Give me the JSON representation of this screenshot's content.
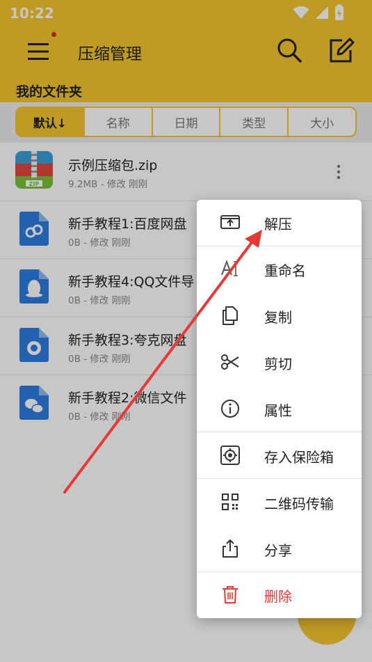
{
  "status": {
    "time": "10:22"
  },
  "appbar": {
    "title": "压缩管理"
  },
  "section": {
    "title": "我的文件夹"
  },
  "sort_tabs": [
    {
      "label": "默认↓",
      "active": true
    },
    {
      "label": "名称"
    },
    {
      "label": "日期"
    },
    {
      "label": "类型"
    },
    {
      "label": "大小"
    }
  ],
  "files": [
    {
      "name": "示例压缩包.zip",
      "meta": "9.2MB - 修改 刚刚",
      "icon": "zip-archive-icon"
    },
    {
      "name": "新手教程1:百度网盘",
      "meta": "0B - 修改 刚刚",
      "icon": "baidu-netdisk-doc-icon"
    },
    {
      "name": "新手教程4:QQ文件导",
      "meta": "0B - 修改 刚刚",
      "icon": "qq-doc-icon"
    },
    {
      "name": "新手教程3:夸克网盘",
      "meta": "0B - 修改 刚刚",
      "icon": "quark-doc-icon"
    },
    {
      "name": "新手教程2:微信文件",
      "meta": "0B - 修改 刚刚",
      "icon": "wechat-doc-icon"
    }
  ],
  "context_menu": [
    {
      "label": "解压",
      "icon": "extract-icon"
    },
    {
      "label": "重命名",
      "icon": "rename-icon"
    },
    {
      "label": "复制",
      "icon": "copy-icon"
    },
    {
      "label": "剪切",
      "icon": "scissors-icon"
    },
    {
      "label": "属性",
      "icon": "info-icon"
    },
    {
      "label": "存入保险箱",
      "icon": "vault-icon"
    },
    {
      "label": "二维码传输",
      "icon": "qrcode-icon"
    },
    {
      "label": "分享",
      "icon": "share-icon"
    },
    {
      "label": "删除",
      "icon": "trash-icon",
      "danger": true
    }
  ],
  "colors": {
    "accent": "#f5c731",
    "danger": "#e53935",
    "annotation": "#e53935"
  }
}
